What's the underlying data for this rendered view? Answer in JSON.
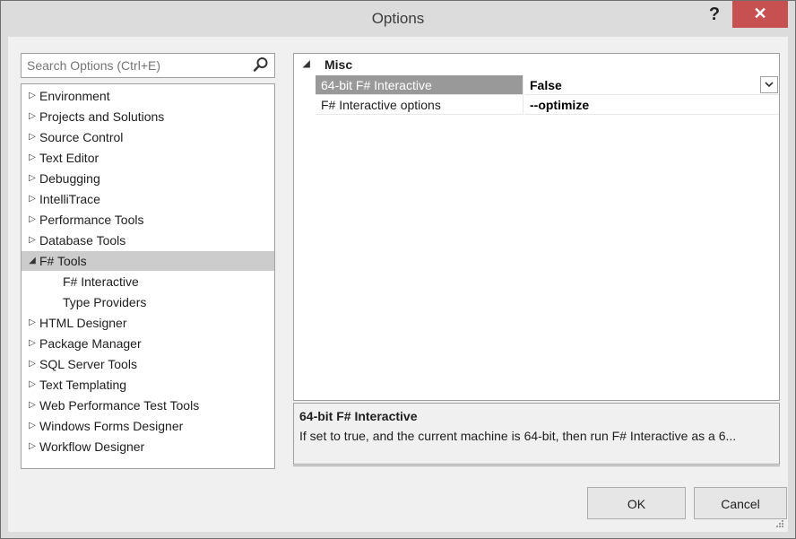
{
  "window": {
    "title": "Options",
    "help_label": "?",
    "close_label": "✕"
  },
  "search": {
    "placeholder": "Search Options (Ctrl+E)"
  },
  "tree": {
    "items": [
      {
        "label": "Environment",
        "expanded": false
      },
      {
        "label": "Projects and Solutions",
        "expanded": false
      },
      {
        "label": "Source Control",
        "expanded": false
      },
      {
        "label": "Text Editor",
        "expanded": false
      },
      {
        "label": "Debugging",
        "expanded": false
      },
      {
        "label": "IntelliTrace",
        "expanded": false
      },
      {
        "label": "Performance Tools",
        "expanded": false
      },
      {
        "label": "Database Tools",
        "expanded": false
      },
      {
        "label": "F# Tools",
        "expanded": true,
        "selected": true
      },
      {
        "label": "F# Interactive",
        "child": true
      },
      {
        "label": "Type Providers",
        "child": true
      },
      {
        "label": "HTML Designer",
        "expanded": false
      },
      {
        "label": "Package Manager",
        "expanded": false
      },
      {
        "label": "SQL Server Tools",
        "expanded": false
      },
      {
        "label": "Text Templating",
        "expanded": false
      },
      {
        "label": "Web Performance Test Tools",
        "expanded": false
      },
      {
        "label": "Windows Forms Designer",
        "expanded": false
      },
      {
        "label": "Workflow Designer",
        "expanded": false
      }
    ],
    "collapsed_glyph": "▷",
    "expanded_glyph": "◢"
  },
  "grid": {
    "category": "Misc",
    "category_glyph": "◢",
    "properties": [
      {
        "name": "64-bit F# Interactive",
        "value": "False"
      },
      {
        "name": "F# Interactive options",
        "value": "--optimize"
      }
    ]
  },
  "description": {
    "title": "64-bit F# Interactive",
    "text": "If set to true, and the current machine is 64-bit, then run F# Interactive as a 6..."
  },
  "buttons": {
    "ok": "OK",
    "cancel": "Cancel"
  }
}
